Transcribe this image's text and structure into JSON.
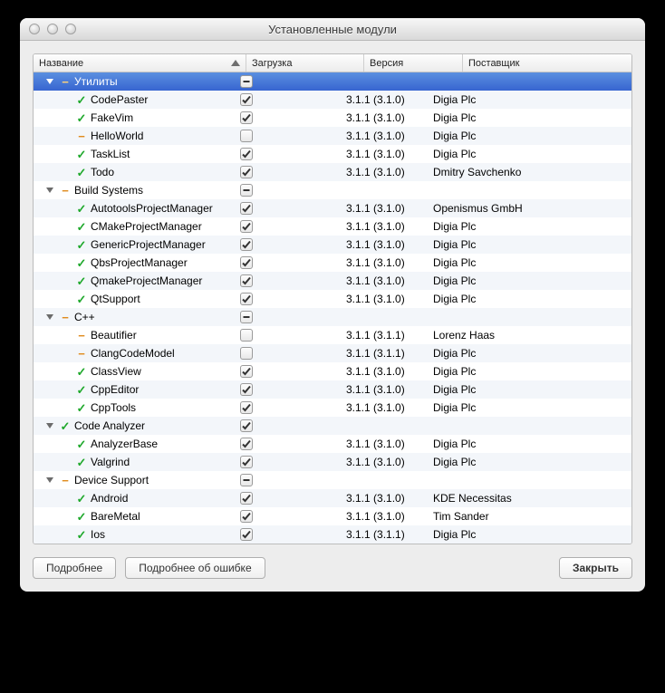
{
  "window": {
    "title": "Установленные модули"
  },
  "columns": {
    "name": "Название",
    "load": "Загрузка",
    "version": "Версия",
    "vendor": "Поставщик"
  },
  "buttons": {
    "details": "Подробнее",
    "error_details": "Подробнее об ошибке",
    "close": "Закрыть"
  },
  "rows": [
    {
      "type": "group",
      "indent": 0,
      "status": "orange",
      "name": "Утилиты",
      "check": "mixed",
      "selected": true
    },
    {
      "type": "item",
      "indent": 1,
      "status": "green",
      "name": "CodePaster",
      "check": "on",
      "version": "3.1.1 (3.1.0)",
      "vendor": "Digia Plc"
    },
    {
      "type": "item",
      "indent": 1,
      "status": "green",
      "name": "FakeVim",
      "check": "on",
      "version": "3.1.1 (3.1.0)",
      "vendor": "Digia Plc"
    },
    {
      "type": "item",
      "indent": 1,
      "status": "orange",
      "name": "HelloWorld",
      "check": "off",
      "version": "3.1.1 (3.1.0)",
      "vendor": "Digia Plc"
    },
    {
      "type": "item",
      "indent": 1,
      "status": "green",
      "name": "TaskList",
      "check": "on",
      "version": "3.1.1 (3.1.0)",
      "vendor": "Digia Plc"
    },
    {
      "type": "item",
      "indent": 1,
      "status": "green",
      "name": "Todo",
      "check": "on",
      "version": "3.1.1 (3.1.0)",
      "vendor": "Dmitry Savchenko"
    },
    {
      "type": "group",
      "indent": 0,
      "status": "orange",
      "name": "Build Systems",
      "check": "mixed"
    },
    {
      "type": "item",
      "indent": 1,
      "status": "green",
      "name": "AutotoolsProjectManager",
      "check": "on",
      "version": "3.1.1 (3.1.0)",
      "vendor": "Openismus GmbH"
    },
    {
      "type": "item",
      "indent": 1,
      "status": "green",
      "name": "CMakeProjectManager",
      "check": "on",
      "version": "3.1.1 (3.1.0)",
      "vendor": "Digia Plc"
    },
    {
      "type": "item",
      "indent": 1,
      "status": "green",
      "name": "GenericProjectManager",
      "check": "on",
      "version": "3.1.1 (3.1.0)",
      "vendor": "Digia Plc"
    },
    {
      "type": "item",
      "indent": 1,
      "status": "green",
      "name": "QbsProjectManager",
      "check": "on",
      "version": "3.1.1 (3.1.0)",
      "vendor": "Digia Plc"
    },
    {
      "type": "item",
      "indent": 1,
      "status": "green",
      "name": "QmakeProjectManager",
      "check": "on",
      "version": "3.1.1 (3.1.0)",
      "vendor": "Digia Plc"
    },
    {
      "type": "item",
      "indent": 1,
      "status": "green",
      "name": "QtSupport",
      "check": "on",
      "version": "3.1.1 (3.1.0)",
      "vendor": "Digia Plc"
    },
    {
      "type": "group",
      "indent": 0,
      "status": "orange",
      "name": "C++",
      "check": "mixed"
    },
    {
      "type": "item",
      "indent": 1,
      "status": "orange",
      "name": "Beautifier",
      "check": "off",
      "version": "3.1.1 (3.1.1)",
      "vendor": "Lorenz Haas"
    },
    {
      "type": "item",
      "indent": 1,
      "status": "orange",
      "name": "ClangCodeModel",
      "check": "off",
      "version": "3.1.1 (3.1.1)",
      "vendor": "Digia Plc"
    },
    {
      "type": "item",
      "indent": 1,
      "status": "green",
      "name": "ClassView",
      "check": "on",
      "version": "3.1.1 (3.1.0)",
      "vendor": "Digia Plc"
    },
    {
      "type": "item",
      "indent": 1,
      "status": "green",
      "name": "CppEditor",
      "check": "on",
      "version": "3.1.1 (3.1.0)",
      "vendor": "Digia Plc"
    },
    {
      "type": "item",
      "indent": 1,
      "status": "green",
      "name": "CppTools",
      "check": "on",
      "version": "3.1.1 (3.1.0)",
      "vendor": "Digia Plc"
    },
    {
      "type": "group",
      "indent": 0,
      "status": "green",
      "name": "Code Analyzer",
      "check": "on"
    },
    {
      "type": "item",
      "indent": 1,
      "status": "green",
      "name": "AnalyzerBase",
      "check": "on",
      "version": "3.1.1 (3.1.0)",
      "vendor": "Digia Plc"
    },
    {
      "type": "item",
      "indent": 1,
      "status": "green",
      "name": "Valgrind",
      "check": "on",
      "version": "3.1.1 (3.1.0)",
      "vendor": "Digia Plc"
    },
    {
      "type": "group",
      "indent": 0,
      "status": "orange",
      "name": "Device Support",
      "check": "mixed"
    },
    {
      "type": "item",
      "indent": 1,
      "status": "green",
      "name": "Android",
      "check": "on",
      "version": "3.1.1 (3.1.0)",
      "vendor": "KDE Necessitas"
    },
    {
      "type": "item",
      "indent": 1,
      "status": "green",
      "name": "BareMetal",
      "check": "on",
      "version": "3.1.1 (3.1.0)",
      "vendor": "Tim Sander"
    },
    {
      "type": "item",
      "indent": 1,
      "status": "green",
      "name": "Ios",
      "check": "on",
      "version": "3.1.1 (3.1.1)",
      "vendor": "Digia Plc"
    }
  ]
}
